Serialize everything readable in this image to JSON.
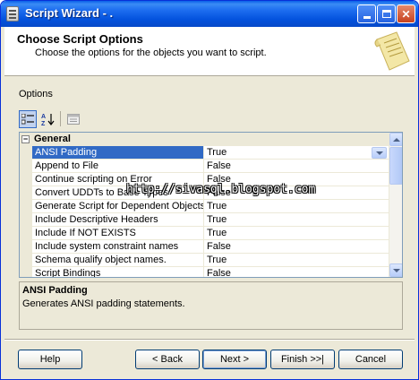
{
  "window": {
    "title": "Script Wizard - ."
  },
  "header": {
    "title": "Choose Script Options",
    "subtitle": "Choose the options for the objects you want to script."
  },
  "options_label": "Options",
  "toolbar": {
    "categorized_icon": "categorized-icon",
    "alphabetical_icon": "sort-az-icon",
    "property_pages_icon": "property-pages-icon"
  },
  "grid": {
    "category": "General",
    "category_toggle": "⊟",
    "rows": [
      {
        "name": "ANSI Padding",
        "value": "True",
        "selected": true
      },
      {
        "name": "Append to File",
        "value": "False"
      },
      {
        "name": "Continue scripting on Error",
        "value": "False"
      },
      {
        "name": "Convert UDDTs to Base Types",
        "value": "False"
      },
      {
        "name": "Generate Script for Dependent Objects",
        "value": "True"
      },
      {
        "name": "Include Descriptive Headers",
        "value": "True"
      },
      {
        "name": "Include If NOT EXISTS",
        "value": "True"
      },
      {
        "name": "Include system constraint names",
        "value": "False"
      },
      {
        "name": "Schema qualify object names.",
        "value": "True"
      },
      {
        "name": "Script Bindings",
        "value": "False"
      }
    ]
  },
  "description": {
    "title": "ANSI Padding",
    "text": "Generates ANSI padding statements."
  },
  "watermark": "http://sivasql.blogspot.com",
  "buttons": {
    "help": "Help",
    "back": "< Back",
    "next": "Next >",
    "finish": "Finish >>|",
    "cancel": "Cancel"
  },
  "colors": {
    "titlebar": "#0453de",
    "selection": "#316ac5",
    "dialog_bg": "#ece9d8"
  }
}
